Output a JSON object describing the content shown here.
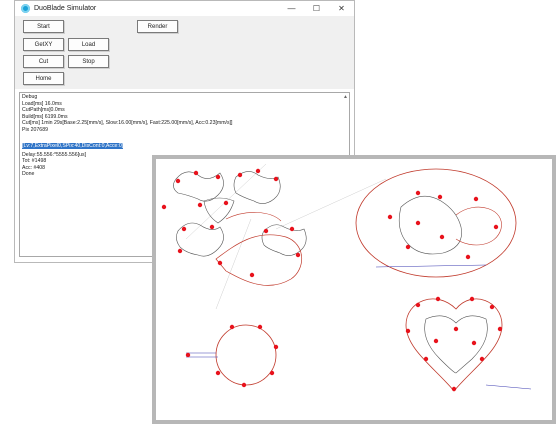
{
  "window": {
    "title": "DuoBlade Simulator",
    "controls": {
      "minimize": "—",
      "maximize": "☐",
      "close": "✕"
    }
  },
  "toolbar": {
    "start_label": "Start",
    "render_label": "Render",
    "getxy_label": "GetXY",
    "load_label": "Load",
    "cut_label": "Cut",
    "stop_label": "Stop",
    "home_label": "Home"
  },
  "debug": {
    "lines": [
      "Debug",
      "Load[ms] 16.0ms",
      "CutPath[ms]0.0ms",
      "Build[ms] 6199.0ms",
      "Cut[ms] 1min 29s[Base:2.25[mm/s], Slow:16.00[mm/s], Fast:225.00[mm/s], Acc:0.23[mm/s]]",
      "Pix 207689",
      "[Lv:7,ExtraPixel0,SPix:40,DisCont:0,Acce:0]",
      "Delay:55.556:*5555.556[us]",
      "Tot: #1498",
      "Acc: #408",
      "Done"
    ],
    "selected_line_index": 6
  },
  "colors": {
    "accent_select": "#2f74c7",
    "path_red": "#c0392b",
    "path_gray": "#555555",
    "marker_red": "#e8121c"
  }
}
